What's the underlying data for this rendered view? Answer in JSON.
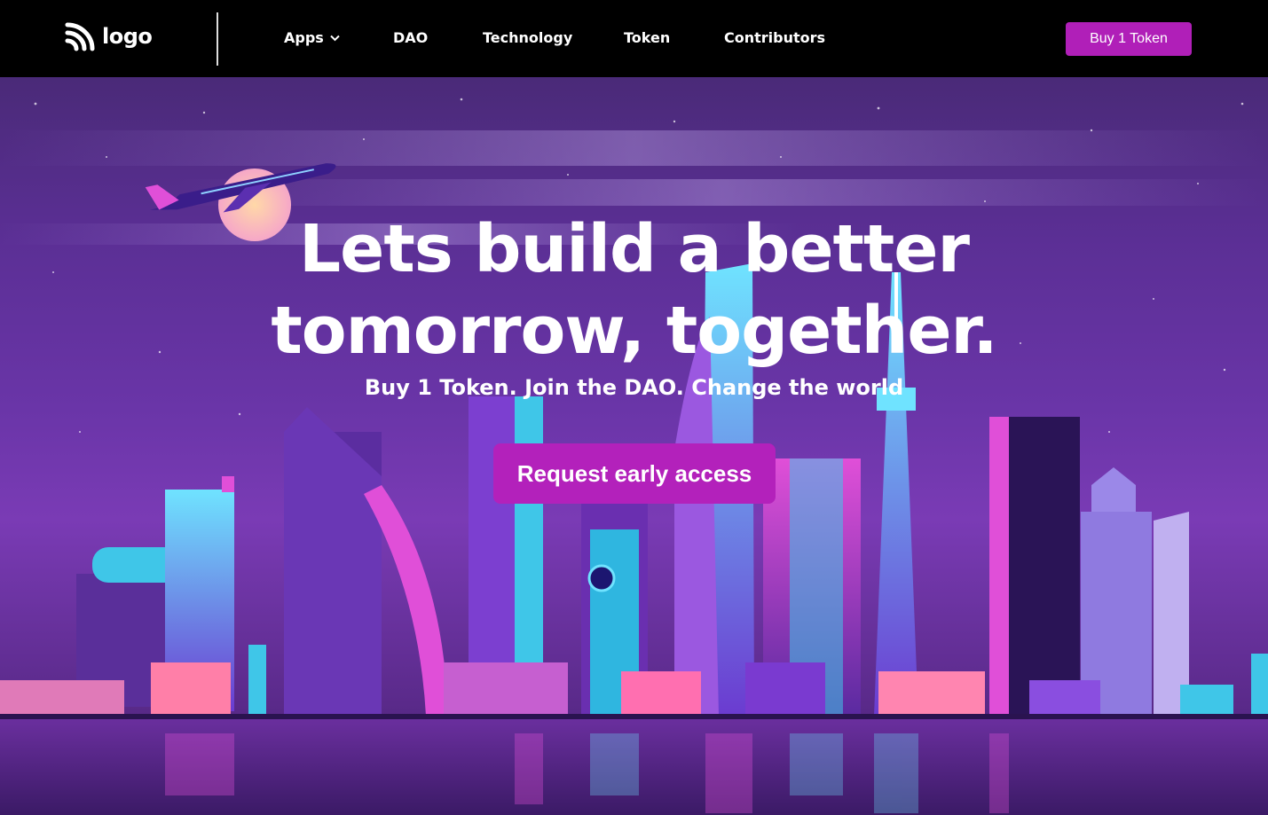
{
  "nav": {
    "logo_text": "logo",
    "items": [
      {
        "label": "Apps"
      },
      {
        "label": "DAO"
      },
      {
        "label": "Technology"
      },
      {
        "label": "Token"
      },
      {
        "label": "Contributors"
      }
    ],
    "buy_label": "Buy 1 Token"
  },
  "hero": {
    "title_line1": "Lets build a better",
    "title_line2": "tomorrow, together.",
    "subtitle": "Buy 1 Token. Join the DAO. Change the world",
    "cta_label": "Request early access"
  },
  "colors": {
    "accent": "#b01fb8",
    "nav_bg": "#000000",
    "sky_top": "#4a2a78",
    "sky_mid": "#7a3bb5",
    "neon_cyan": "#3fd6f5",
    "neon_pink": "#e04fd8"
  },
  "icons": {
    "logo": "signal-icon",
    "apps_dropdown": "chevron-down-icon"
  }
}
